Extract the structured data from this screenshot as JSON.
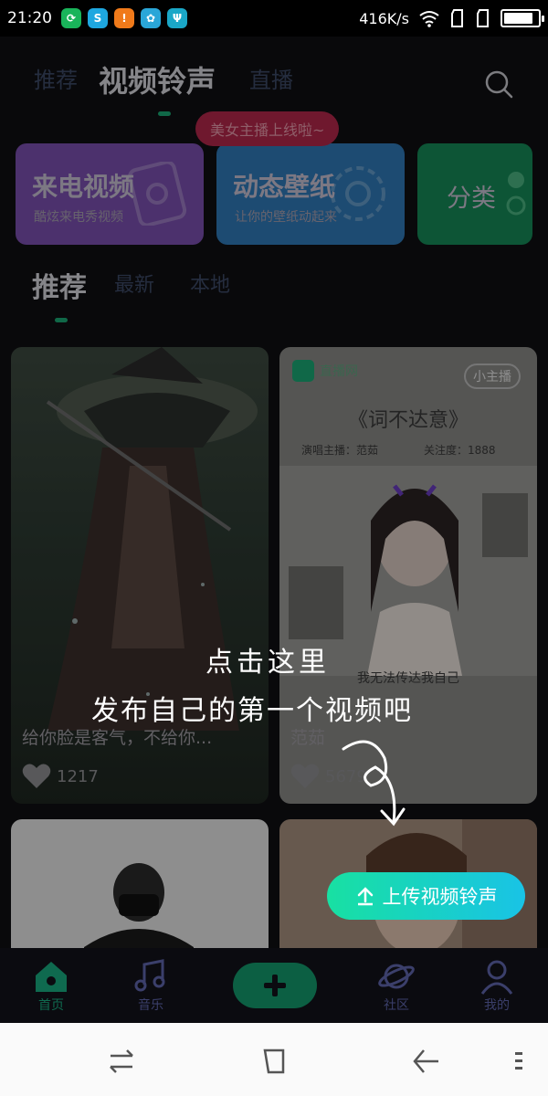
{
  "status_bar": {
    "time": "21:20",
    "speed": "416K/s",
    "notifications": [
      {
        "icon": "wechat-icon",
        "color": "#19b45a",
        "glyph": "⟳"
      },
      {
        "icon": "app-icon",
        "color": "#1ea7e0",
        "glyph": "S"
      },
      {
        "icon": "warning-icon",
        "color": "#f07a1a",
        "glyph": "!"
      },
      {
        "icon": "gallery-icon",
        "color": "#2aa6d8",
        "glyph": "✿"
      },
      {
        "icon": "usb-icon",
        "color": "#1aa7c7",
        "glyph": "Ψ"
      }
    ],
    "battery_level": 0.85
  },
  "top_tabs": {
    "recommend": "推荐",
    "video_ringtone": "视频铃声",
    "live": "直播"
  },
  "live_banner": "美女主播上线啦~",
  "features": [
    {
      "title": "来电视频",
      "subtitle": "酷炫来电秀视频",
      "color": "#7b4fb0"
    },
    {
      "title": "动态壁纸",
      "subtitle": "让你的壁纸动起来",
      "color": "#2f79b8"
    },
    {
      "title": "分类",
      "subtitle": "",
      "color": "#158a57"
    }
  ],
  "sub_tabs": {
    "recommend": "推荐",
    "latest": "最新",
    "local": "本地"
  },
  "cards": [
    {
      "caption": "给你脸是客气，不给你...",
      "likes": "1217"
    },
    {
      "caption": "范茹",
      "likes": "5679",
      "brand": "直播网",
      "badge": "小主播",
      "poster_title": "《词不达意》",
      "singer_label": "演唱主播：范茹",
      "fans_label": "关注度：1888",
      "poster_line": "我无法传达我自己"
    },
    {
      "caption": "",
      "likes": ""
    },
    {
      "caption": "",
      "likes": ""
    }
  ],
  "overlay": {
    "hint_line1": "点击这里",
    "hint_line2": "发布自己的第一个视频吧",
    "upload_label": "上传视频铃声"
  },
  "bottom_nav": {
    "home": "首页",
    "music": "音乐",
    "community": "社区",
    "mine": "我的"
  },
  "colors": {
    "accent": "#18e0a2",
    "active_nav": "#0f6a4f",
    "inactive": "#3c4a66"
  }
}
